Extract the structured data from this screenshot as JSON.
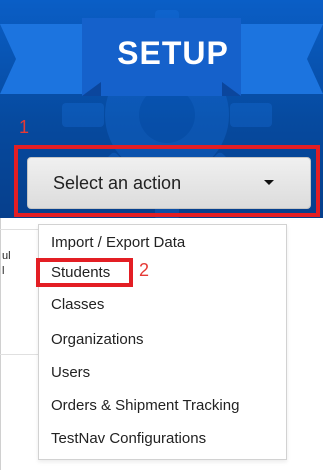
{
  "panel": {
    "title": "SETUP",
    "accent_color": "#0a5ec6",
    "gear_icon": "gear-icon"
  },
  "annotations": {
    "step_one": "1",
    "step_two": "2",
    "highlight_color": "#e31e24"
  },
  "action_select": {
    "label": "Select an action",
    "caret_icon": "caret-down-icon"
  },
  "menu": {
    "items": [
      "Import / Export Data",
      "Students",
      "Classes",
      "Organizations",
      "Users",
      "Orders & Shipment Tracking",
      "TestNav Configurations"
    ]
  },
  "background_fragments": {
    "line_1": "ul",
    "line_2": "l"
  }
}
